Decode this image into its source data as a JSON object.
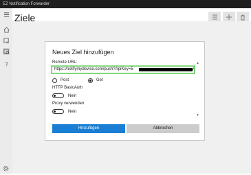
{
  "window": {
    "title": "EZ Notification Forwarder"
  },
  "page": {
    "title": "Ziele"
  },
  "sidebar": {
    "icons": [
      "hamburger-icon",
      "home-icon",
      "forward-icon",
      "target-icon",
      "help-icon",
      "settings-icon"
    ]
  },
  "toolbar": {
    "icons": [
      "list-icon",
      "add-icon",
      "delete-icon"
    ]
  },
  "dialog": {
    "title": "Neues Ziel hinzufügen",
    "remote_url_label": "Remote URL:",
    "remote_url_value": "https://notifymydevice.com/push?ApiKey=5",
    "remote_url_tail": "A",
    "method": {
      "options": [
        "Post",
        "Get"
      ],
      "selected": "Get"
    },
    "basic_auth": {
      "label": "HTTP BasicAuth",
      "state": "Nein"
    },
    "proxy": {
      "label": "Proxy verwenden",
      "state": "Nein"
    },
    "add_button": "Hinzufügen",
    "cancel_button": "Abbrechen"
  },
  "colors": {
    "accent": "#1a7fd4",
    "focus_border": "#5ac85a",
    "titlebar": "#1f1f1f"
  }
}
